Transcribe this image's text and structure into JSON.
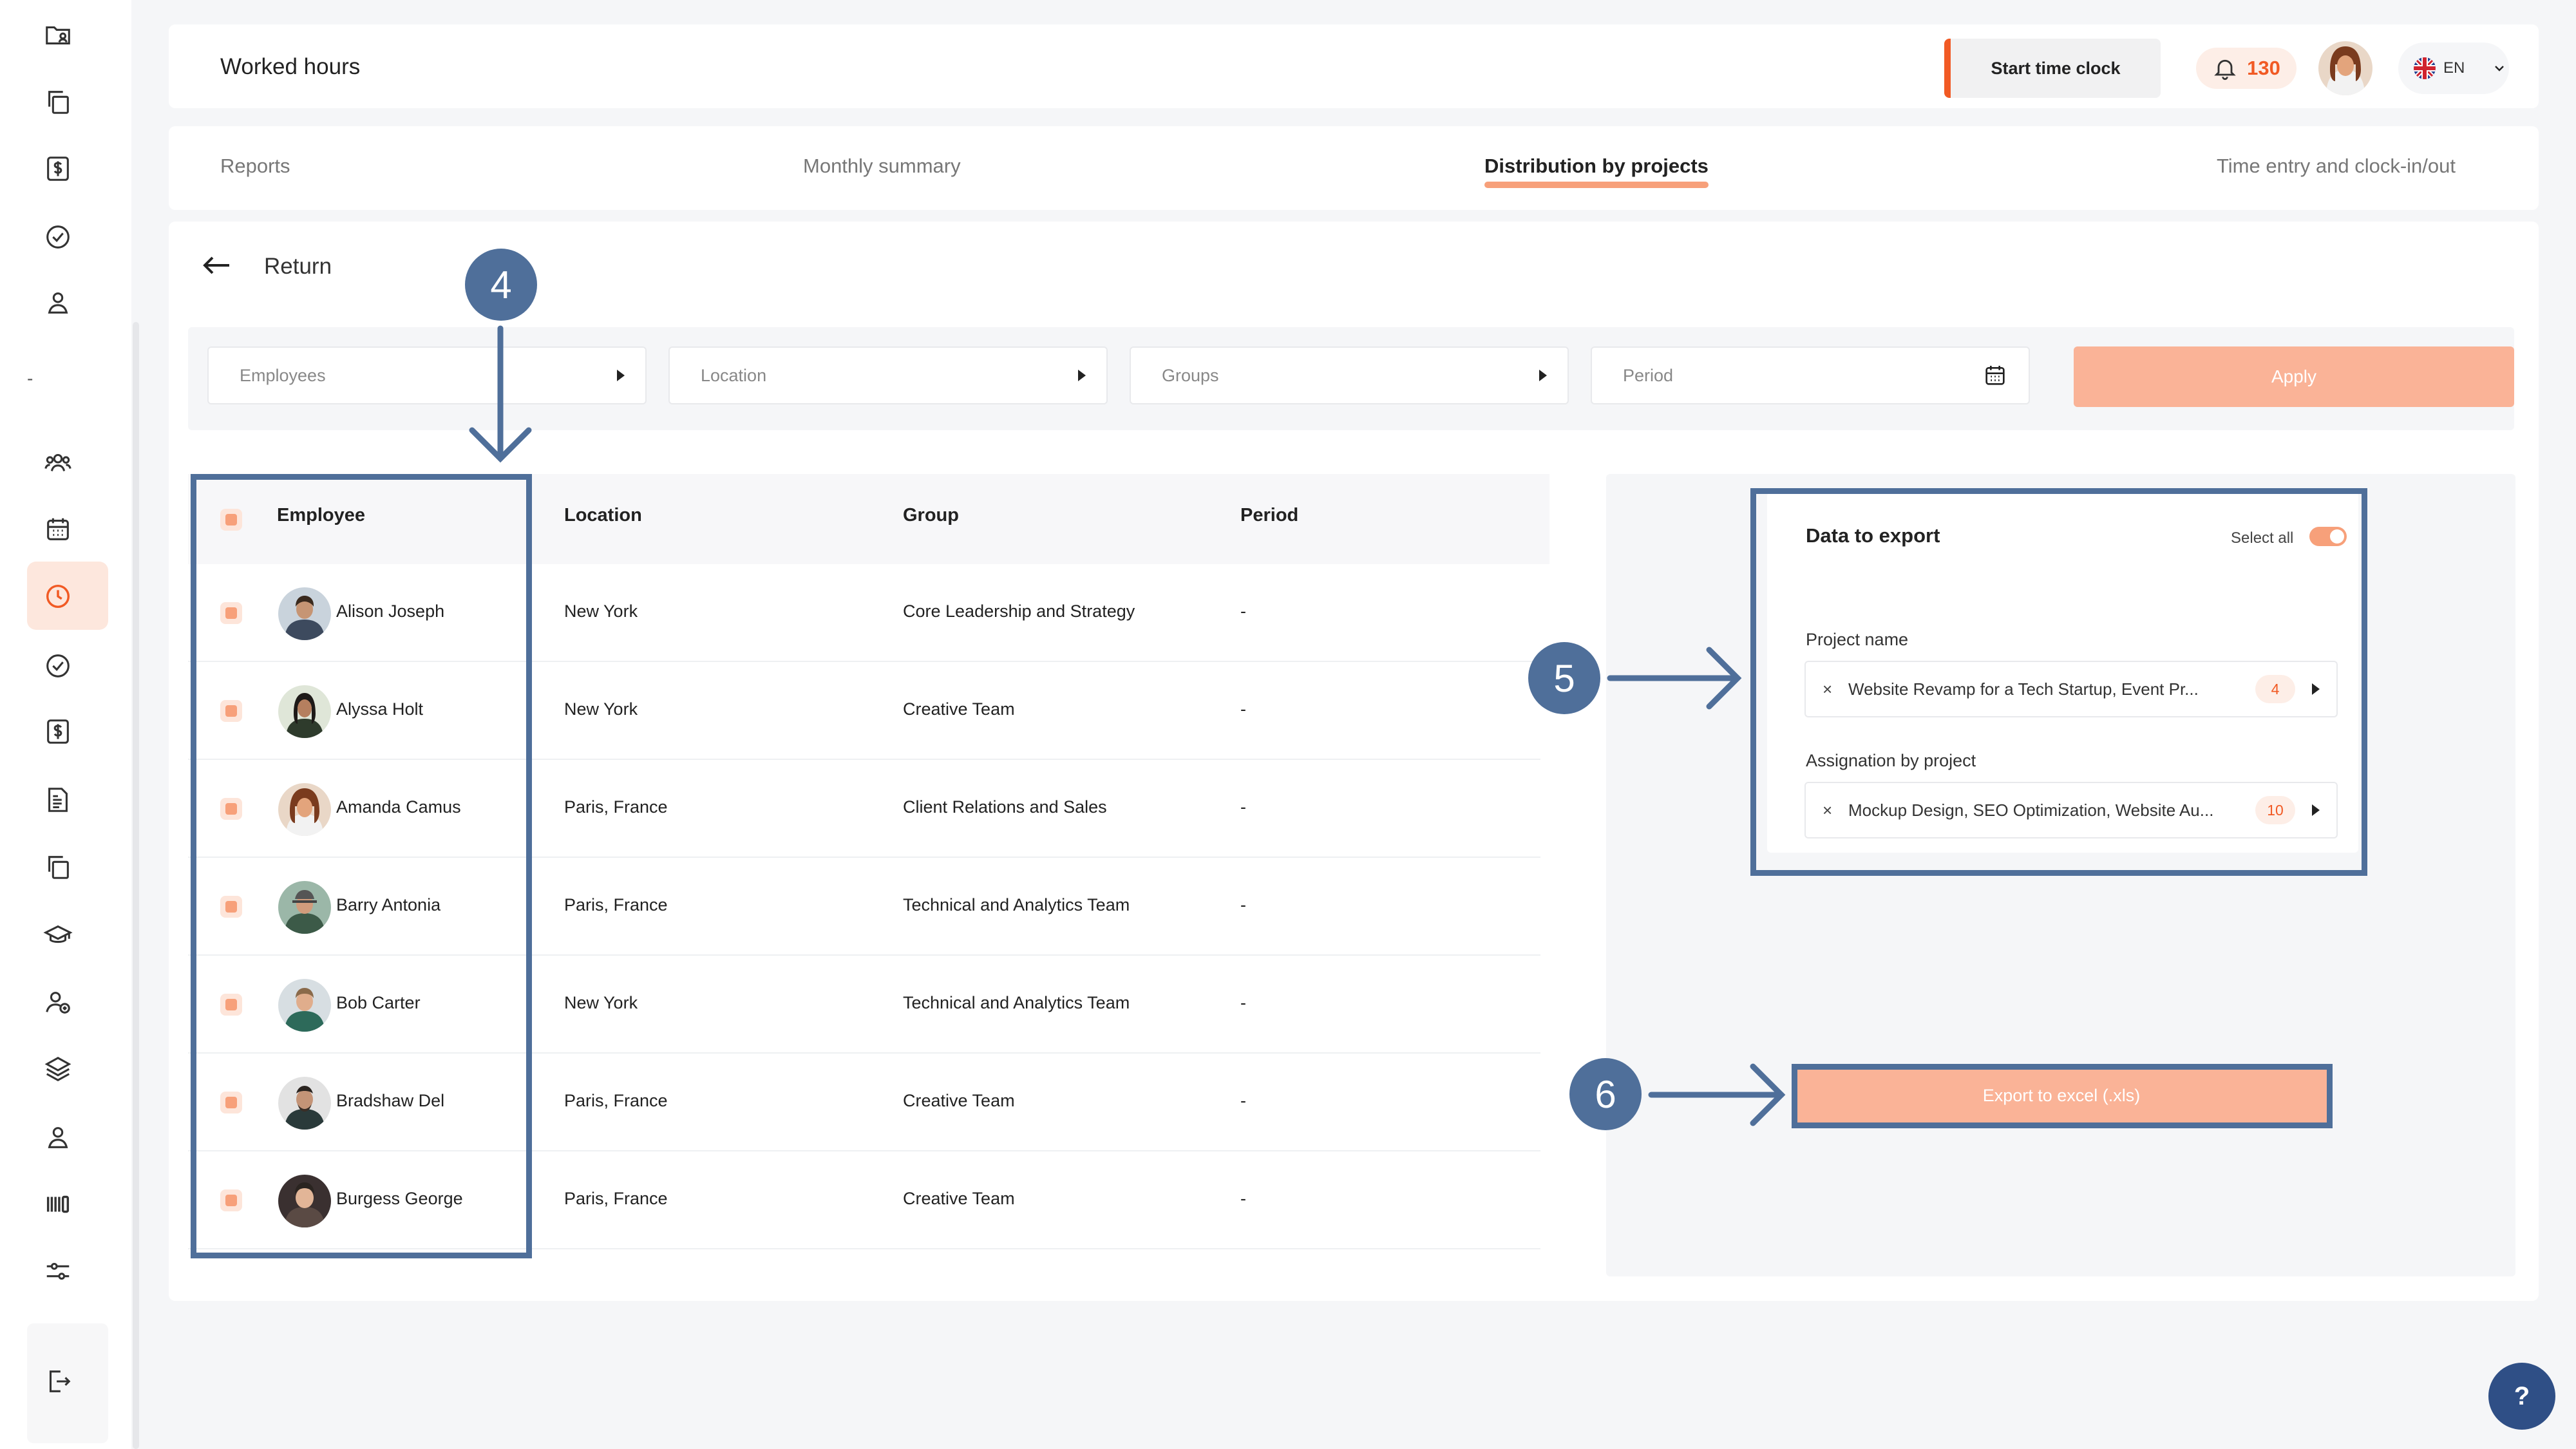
{
  "header": {
    "title": "Worked hours",
    "clock_button": "Start time clock",
    "notifications_count": "130",
    "language": "EN"
  },
  "sidebar": {
    "dash": "-",
    "icons": [
      "folder-user-icon",
      "copy-icon",
      "dollar-icon",
      "check-circle-icon",
      "user-icon",
      "users-group-icon",
      "calendar-icon",
      "clock-icon",
      "check-circle-icon",
      "dollar-icon",
      "report-icon",
      "copy-icon",
      "graduation-cap-icon",
      "user-add-icon",
      "layers-icon",
      "user-icon",
      "barcode-icon",
      "sliders-icon"
    ],
    "active": "clock-icon"
  },
  "tabs": [
    {
      "label": "Reports"
    },
    {
      "label": "Monthly summary"
    },
    {
      "label": "Distribution by projects"
    },
    {
      "label": "Time entry and clock-in/out"
    }
  ],
  "return_label": "Return",
  "filters": {
    "employees": "Employees",
    "location": "Location",
    "groups": "Groups",
    "period": "Period",
    "apply": "Apply"
  },
  "table": {
    "headers": {
      "employee": "Employee",
      "location": "Location",
      "group": "Group",
      "period": "Period"
    },
    "rows": [
      {
        "name": "Alison Joseph",
        "location": "New York",
        "group": "Core Leadership and Strategy",
        "period": "-"
      },
      {
        "name": "Alyssa Holt",
        "location": "New York",
        "group": "Creative Team",
        "period": "-"
      },
      {
        "name": "Amanda Camus",
        "location": "Paris, France",
        "group": "Client Relations and Sales",
        "period": "-"
      },
      {
        "name": "Barry Antonia",
        "location": "Paris, France",
        "group": "Technical and Analytics Team",
        "period": "-"
      },
      {
        "name": "Bob Carter",
        "location": "New York",
        "group": "Technical and Analytics Team",
        "period": "-"
      },
      {
        "name": "Bradshaw Del",
        "location": "Paris, France",
        "group": "Creative Team",
        "period": "-"
      },
      {
        "name": "Burgess George",
        "location": "Paris, France",
        "group": "Creative Team",
        "period": "-"
      }
    ]
  },
  "export": {
    "title": "Data to export",
    "select_all": "Select all",
    "select_all_on": true,
    "project_label": "Project name",
    "project_value": "Website Revamp for a Tech Startup, Event Pr...",
    "project_count": "4",
    "assignment_label": "Assignation by project",
    "assignment_value": "Mockup Design, SEO Optimization, Website Au...",
    "assignment_count": "10",
    "remove_symbol": "×",
    "button": "Export to excel (.xls)"
  },
  "annotations": {
    "step4": "4",
    "step5": "5",
    "step6": "6"
  },
  "help": "?",
  "colors": {
    "accent": "#f15a24",
    "accent_light": "#fab397",
    "annotation": "#4f6f9a",
    "help": "#2f4f86"
  }
}
